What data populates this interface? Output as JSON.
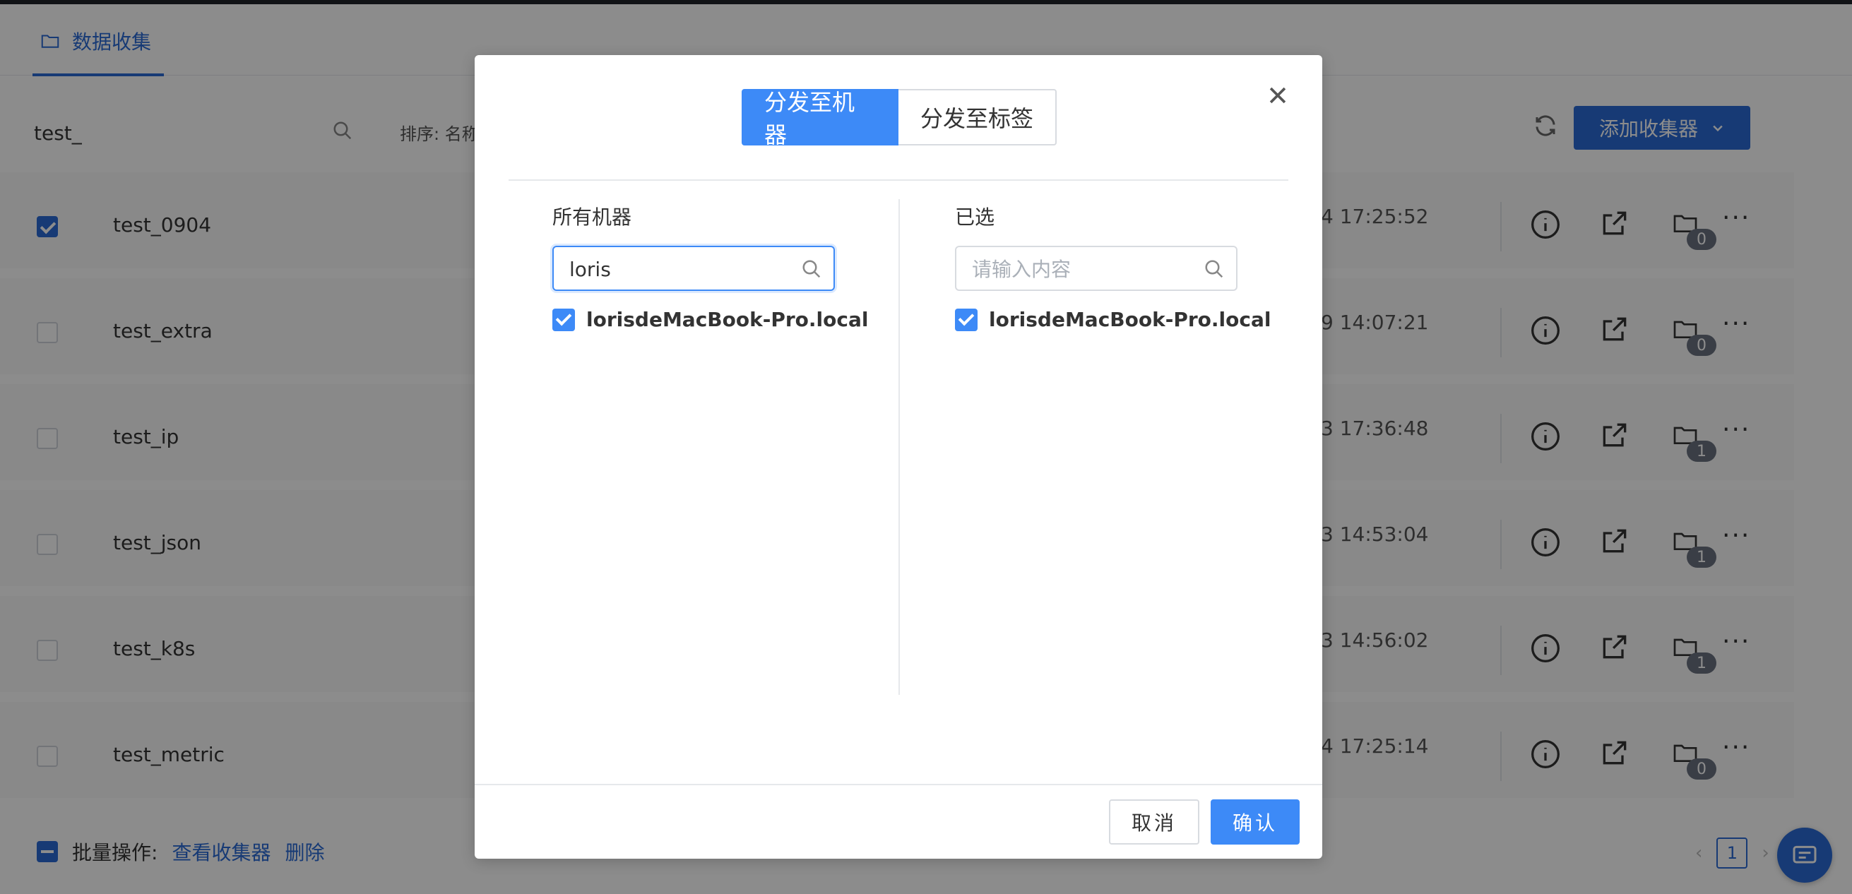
{
  "app": {
    "tab_label": "数据收集"
  },
  "toolbar": {
    "search_value": "test_",
    "sort_label": "排序: 名称",
    "add_button_label": "添加收集器"
  },
  "rows": [
    {
      "name": "test_0904",
      "time": "4 17:25:52",
      "checked": true,
      "count": "0"
    },
    {
      "name": "test_extra",
      "time": "9 14:07:21",
      "checked": false,
      "count": "0"
    },
    {
      "name": "test_ip",
      "time": "3 17:36:48",
      "checked": false,
      "count": "1"
    },
    {
      "name": "test_json",
      "time": "3 14:53:04",
      "checked": false,
      "count": "1"
    },
    {
      "name": "test_k8s",
      "time": "3 14:56:02",
      "checked": false,
      "count": "1"
    },
    {
      "name": "test_metric",
      "time": "4 17:25:14",
      "checked": false,
      "count": "0"
    }
  ],
  "batch": {
    "label": "批量操作:",
    "view_link": "查看收集器",
    "delete_link": "删除"
  },
  "pager": {
    "current": "1"
  },
  "modal": {
    "seg_machine": "分发至机器",
    "seg_tag": "分发至标签",
    "left": {
      "title": "所有机器",
      "search_value": "loris",
      "item": "lorisdeMacBook-Pro.local"
    },
    "right": {
      "title": "已选",
      "search_placeholder": "请输入内容",
      "item": "lorisdeMacBook-Pro.local"
    },
    "cancel_label": "取消",
    "confirm_label": "确认"
  },
  "colors": {
    "primary": "#2a6bd6",
    "modal_primary": "#3d8af7"
  }
}
